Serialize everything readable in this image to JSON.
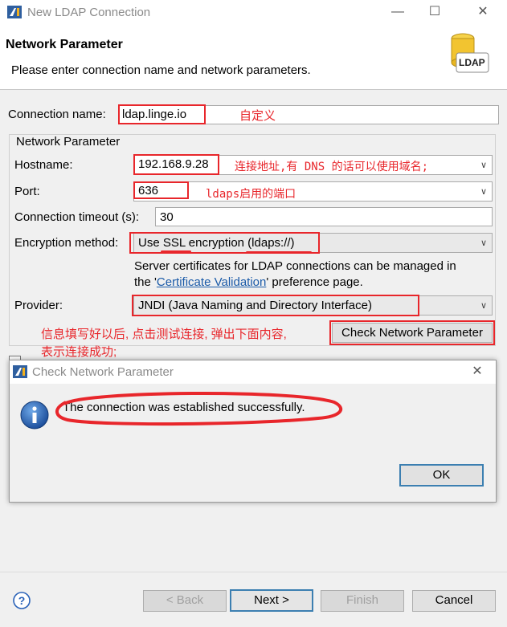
{
  "window": {
    "title": "New LDAP Connection",
    "minimize_icon": "minimize-icon",
    "maximize_icon": "maximize-icon",
    "close_icon": "close-icon"
  },
  "header": {
    "title": "Network Parameter",
    "description": "Please enter connection name and network parameters.",
    "icon_label": "LDAP"
  },
  "form": {
    "connection_name_label": "Connection name:",
    "connection_name_value": "ldap.linge.io",
    "group_title": "Network Parameter",
    "hostname_label": "Hostname:",
    "hostname_value": "192.168.9.28",
    "port_label": "Port:",
    "port_value": "636",
    "timeout_label": "Connection timeout (s):",
    "timeout_value": "30",
    "encryption_label": "Encryption method:",
    "encryption_value": "Use SSL encryption (ldaps://)",
    "cert_note_1": "Server certificates for LDAP connections can be managed in",
    "cert_note_2_prefix": "the '",
    "cert_note_link": "Certificate Validation",
    "cert_note_2_suffix": "' preference page.",
    "provider_label": "Provider:",
    "provider_value": "JNDI (Java Naming and Directory Interface)",
    "check_button": "Check Network Parameter"
  },
  "annotations": {
    "connection_name_note": "自定义",
    "hostname_note": "连接地址,有 DNS 的话可以使用域名;",
    "port_note": "ldaps启用的端口",
    "step_note_1": "信息填写好以后, 点击测试连接, 弹出下面内容,",
    "step_note_2": "表示连接成功;"
  },
  "dialog": {
    "title": "Check Network Parameter",
    "message": "The connection was established successfully.",
    "ok_button": "OK",
    "info_icon": "info-icon"
  },
  "footer": {
    "help_icon": "help-icon",
    "back_button": "< Back",
    "next_button": "Next >",
    "finish_button": "Finish",
    "cancel_button": "Cancel"
  },
  "colors": {
    "annotation_red": "#e8262b",
    "link_blue": "#1a5aa8",
    "default_button_border": "#3c7fb1"
  }
}
